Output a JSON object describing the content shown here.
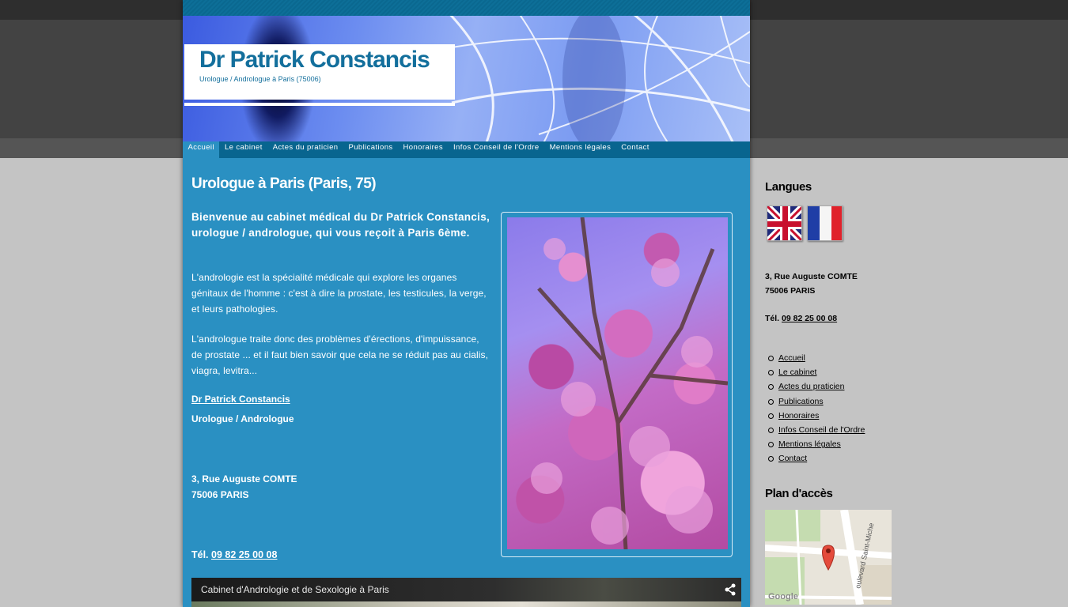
{
  "site": {
    "title": "Dr Patrick Constancis",
    "subtitle": "Urologue / Andrologue à Paris (75006)"
  },
  "nav": {
    "items": [
      {
        "label": "Accueil",
        "active": true
      },
      {
        "label": "Le cabinet"
      },
      {
        "label": "Actes du praticien"
      },
      {
        "label": "Publications"
      },
      {
        "label": "Honoraires"
      },
      {
        "label": "Infos Conseil de l'Ordre"
      },
      {
        "label": "Mentions légales"
      },
      {
        "label": "Contact"
      }
    ]
  },
  "main": {
    "heading": "Urologue à Paris (Paris, 75)",
    "intro": "Bienvenue au cabinet médical du Dr Patrick Constancis, urologue / andrologue, qui vous reçoit à Paris 6ème.",
    "paragraph1": "L'andrologie est la spécialité médicale qui explore les organes génitaux de l'homme : c'est à dire la prostate, les testicules, la verge, et leurs pathologies.",
    "paragraph2": "L'andrologue traite donc des problèmes d'érections, d'impuissance, de prostate ... et il faut bien savoir que cela ne se réduit pas au cialis, viagra, levitra...",
    "doctor_link": "Dr Patrick Constancis",
    "doctor_role": "Urologue / Andrologue",
    "address_line1": "3, Rue Auguste COMTE",
    "address_line2": "75006 PARIS",
    "tel_label": "Tél.",
    "tel_number": "09 82 25 00 08",
    "video_title": "Cabinet d'Andrologie et de Sexologie à Paris"
  },
  "sidebar": {
    "languages_heading": "Langues",
    "flags": [
      {
        "icon": "uk-flag-icon"
      },
      {
        "icon": "france-flag-icon"
      }
    ],
    "address_line1": "3, Rue Auguste COMTE",
    "address_line2": "75006 PARIS",
    "tel_label": "Tél.",
    "tel_number": "09 82 25 00 08",
    "menu": [
      "Accueil",
      "Le cabinet",
      "Actes du praticien",
      "Publications",
      "Honoraires",
      "Infos Conseil de l'Ordre",
      "Mentions légales",
      "Contact"
    ],
    "map_heading": "Plan d'accès",
    "map_street": "oulevard Saint-Miche",
    "map_brand": "Google"
  },
  "colors": {
    "main_bg": "#2a90c2",
    "nav_bg": "#08658f",
    "title_color": "#136f9c",
    "page_bg": "#c4c4c4"
  }
}
